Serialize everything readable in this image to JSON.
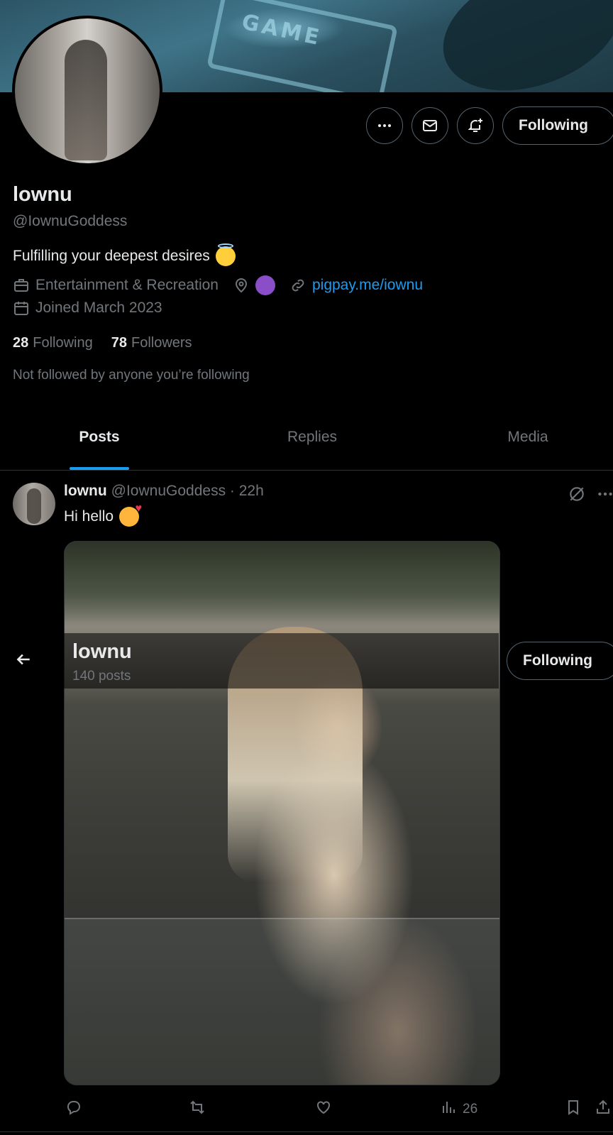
{
  "profile": {
    "name": "lownu",
    "handle": "@IownuGoddess",
    "bio": "Fulfilling your deepest desires",
    "category": "Entertainment & Recreation",
    "website": "pigpay.me/iownu",
    "joined": "Joined March 2023",
    "following_count": "28",
    "following_label": "Following",
    "followers_count": "78",
    "followers_label": "Followers",
    "not_followed": "Not followed by anyone you’re following"
  },
  "actions": {
    "follow_state": "Following"
  },
  "tabs": [
    {
      "label": "Posts",
      "active": true
    },
    {
      "label": "Replies",
      "active": false
    },
    {
      "label": "Media",
      "active": false
    }
  ],
  "post": {
    "author": "lownu",
    "handle_time": "@IownuGoddess · 22h",
    "text": "Hi hello",
    "views": "26"
  },
  "sticky_header": {
    "title": "lownu",
    "subtitle": "140 posts",
    "follow_state": "Following"
  },
  "colors": {
    "accent": "#1d9bf0",
    "text_primary": "#e7e9ea",
    "text_secondary": "#71767b",
    "border": "#2f3336",
    "background": "#000000"
  },
  "icons": [
    "more-icon",
    "mail-icon",
    "bell-plus-icon",
    "briefcase-icon",
    "location-icon",
    "link-icon",
    "calendar-icon",
    "back-arrow-icon",
    "grok-icon",
    "reply-icon",
    "repost-icon",
    "like-icon",
    "views-icon",
    "bookmark-icon",
    "share-icon"
  ]
}
